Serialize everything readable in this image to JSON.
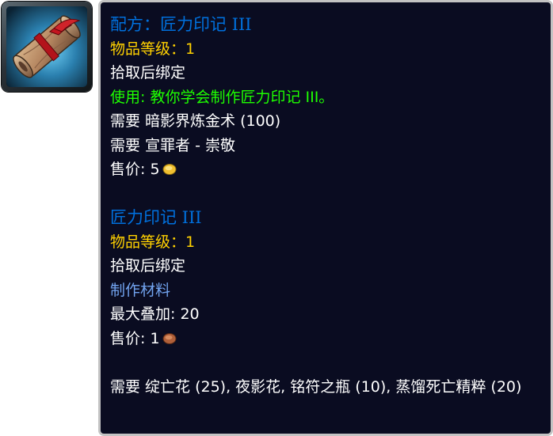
{
  "icon": {
    "name": "recipe-scroll-icon",
    "border_color": "#3a4248",
    "glow_color": "#4fb6e6"
  },
  "tooltip": {
    "background": "#0a0c21",
    "border": "#c3c3c3",
    "recipe": {
      "title": "配方：匠力印记 III",
      "item_level": "物品等级：1",
      "binding": "拾取后绑定",
      "use": "使用: 教你学会制作匠力印记 III。",
      "requires_skill": "需要 暗影界炼金术 (100)",
      "requires_reputation": "需要 宣罪者 - 崇敬",
      "sell_price_label": "售价: 5",
      "sell_price_coin": "gold-coin"
    },
    "crafted_item": {
      "title": "匠力印记 III",
      "item_level": "物品等级：1",
      "binding": "拾取后绑定",
      "materials_label": "制作材料",
      "max_stack": "最大叠加: 20",
      "sell_price_label": "售价: 1",
      "sell_price_coin": "copper-coin"
    },
    "reagents": "需要 绽亡花 (25), 夜影花, 铭符之瓶 (10), 蒸馏死亡精粹 (20)"
  },
  "colors": {
    "epic_rare_blue": "#0070dd",
    "item_level_yellow": "#ffd100",
    "use_green": "#1eff00",
    "label_blue": "#72a4f0",
    "gold_coin": "#f0c030",
    "copper_coin": "#b0603a"
  }
}
